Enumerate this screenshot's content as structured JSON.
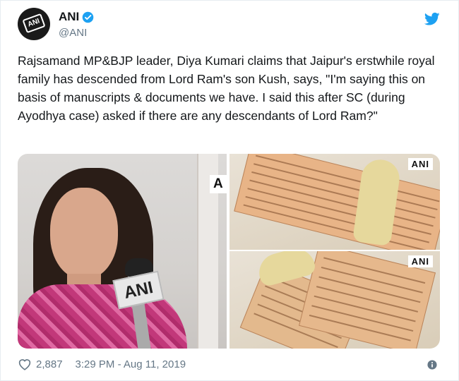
{
  "author": {
    "display_name": "ANI",
    "handle": "@ANI",
    "verified": true,
    "avatar_text": "ANI"
  },
  "tweet": {
    "text": "Rajsamand MP&BJP leader, Diya Kumari claims that Jaipur's erstwhile royal family has descended from Lord Ram's son Kush, says, \"I'm saying this on basis of manuscripts & documents we have. I said this after SC (during Ayodhya case) asked if there are any descendants of Lord Ram?\""
  },
  "media": {
    "watermark": "ANI",
    "watermark_cut": "A",
    "mic_flag_text": "ANI"
  },
  "footer": {
    "likes": "2,887",
    "timestamp": "3:29 PM - Aug 11, 2019"
  },
  "icons": {
    "brand": "twitter-bird-icon",
    "verified": "verified-badge-icon",
    "like": "heart-icon",
    "info": "info-icon"
  },
  "colors": {
    "brand": "#1da1f2",
    "text": "#14171a",
    "secondary": "#657786"
  }
}
